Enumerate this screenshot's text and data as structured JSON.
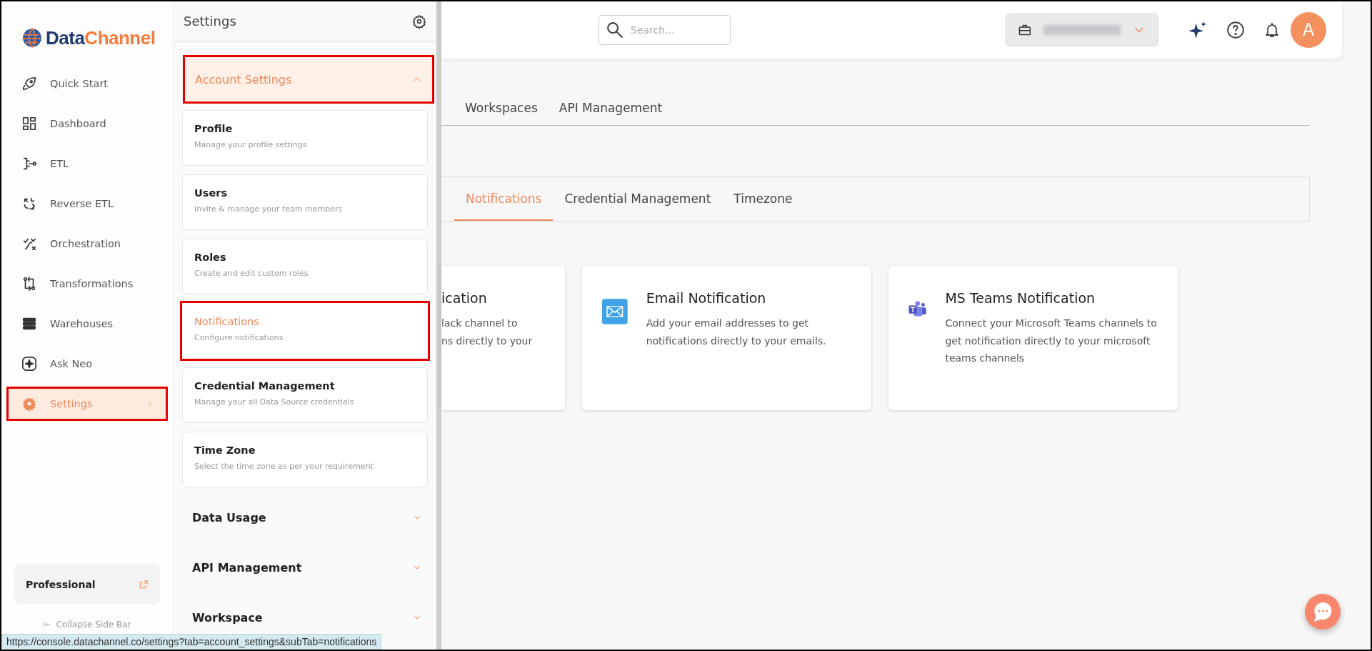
{
  "sidebar": {
    "logo": {
      "part_1": "Data",
      "part_2": "Channel"
    },
    "items": [
      {
        "label": "Quick Start",
        "selected": false,
        "highlighted": false
      },
      {
        "label": "Dashboard",
        "selected": false,
        "highlighted": false
      },
      {
        "label": "ETL",
        "selected": false,
        "highlighted": false
      },
      {
        "label": "Reverse ETL",
        "selected": false,
        "highlighted": false
      },
      {
        "label": "Orchestration",
        "selected": false,
        "highlighted": false
      },
      {
        "label": "Transformations",
        "selected": false,
        "highlighted": false
      },
      {
        "label": "Warehouses",
        "selected": false,
        "highlighted": false
      },
      {
        "label": "Ask Neo",
        "selected": false,
        "highlighted": false
      },
      {
        "label": "Settings",
        "selected": true,
        "highlighted": true
      }
    ],
    "plan": {
      "label": "Professional"
    },
    "collapse": "Collapse Side Bar"
  },
  "settings_panel": {
    "title": "Settings",
    "groups": [
      {
        "label": "Account Settings",
        "expanded": true,
        "highlighted": true,
        "children": [
          {
            "title": "Profile",
            "description": "Manage your profile settings",
            "selected": false,
            "highlighted": false
          },
          {
            "title": "Users",
            "description": "Invite & manage your team members",
            "selected": false,
            "highlighted": false
          },
          {
            "title": "Roles",
            "description": "Create and edit custom roles",
            "selected": false,
            "highlighted": false
          },
          {
            "title": "Notifications",
            "description": "Configure notifications",
            "selected": true,
            "highlighted": true
          },
          {
            "title": "Credential Management",
            "description": "Manage your all Data Source credentials",
            "selected": false,
            "highlighted": false
          },
          {
            "title": "Time Zone",
            "description": "Select the time zone as per your requirement",
            "selected": false,
            "highlighted": false
          }
        ]
      },
      {
        "label": "Data Usage",
        "expanded": false,
        "highlighted": false
      },
      {
        "label": "API Management",
        "expanded": false,
        "highlighted": false
      },
      {
        "label": "Workspace",
        "expanded": false,
        "highlighted": false
      }
    ]
  },
  "top_bar": {
    "search": {
      "placeholder": "Search..."
    },
    "avatar": "A"
  },
  "tabs": [
    {
      "label": "Workspaces",
      "selected": false
    },
    {
      "label": "API Management",
      "selected": false
    }
  ],
  "sub_tabs": [
    {
      "label": "Notifications",
      "selected": true
    },
    {
      "label": "Credential Management",
      "selected": false
    },
    {
      "label": "Timezone",
      "selected": false
    }
  ],
  "cards": [
    {
      "kind": "partial",
      "title": "ication",
      "description": "lack channel to\nns directly to your"
    },
    {
      "kind": "email",
      "title": "Email Notification",
      "description": "Add your email addresses to get notifications directly to your emails."
    },
    {
      "kind": "teams",
      "title": "MS Teams Notification",
      "description": "Connect your Microsoft Teams channels to get notification directly to your microsoft teams channels"
    }
  ],
  "status_bar": "https://console.datachannel.co/settings?tab=account_settings&subTab=notifications"
}
